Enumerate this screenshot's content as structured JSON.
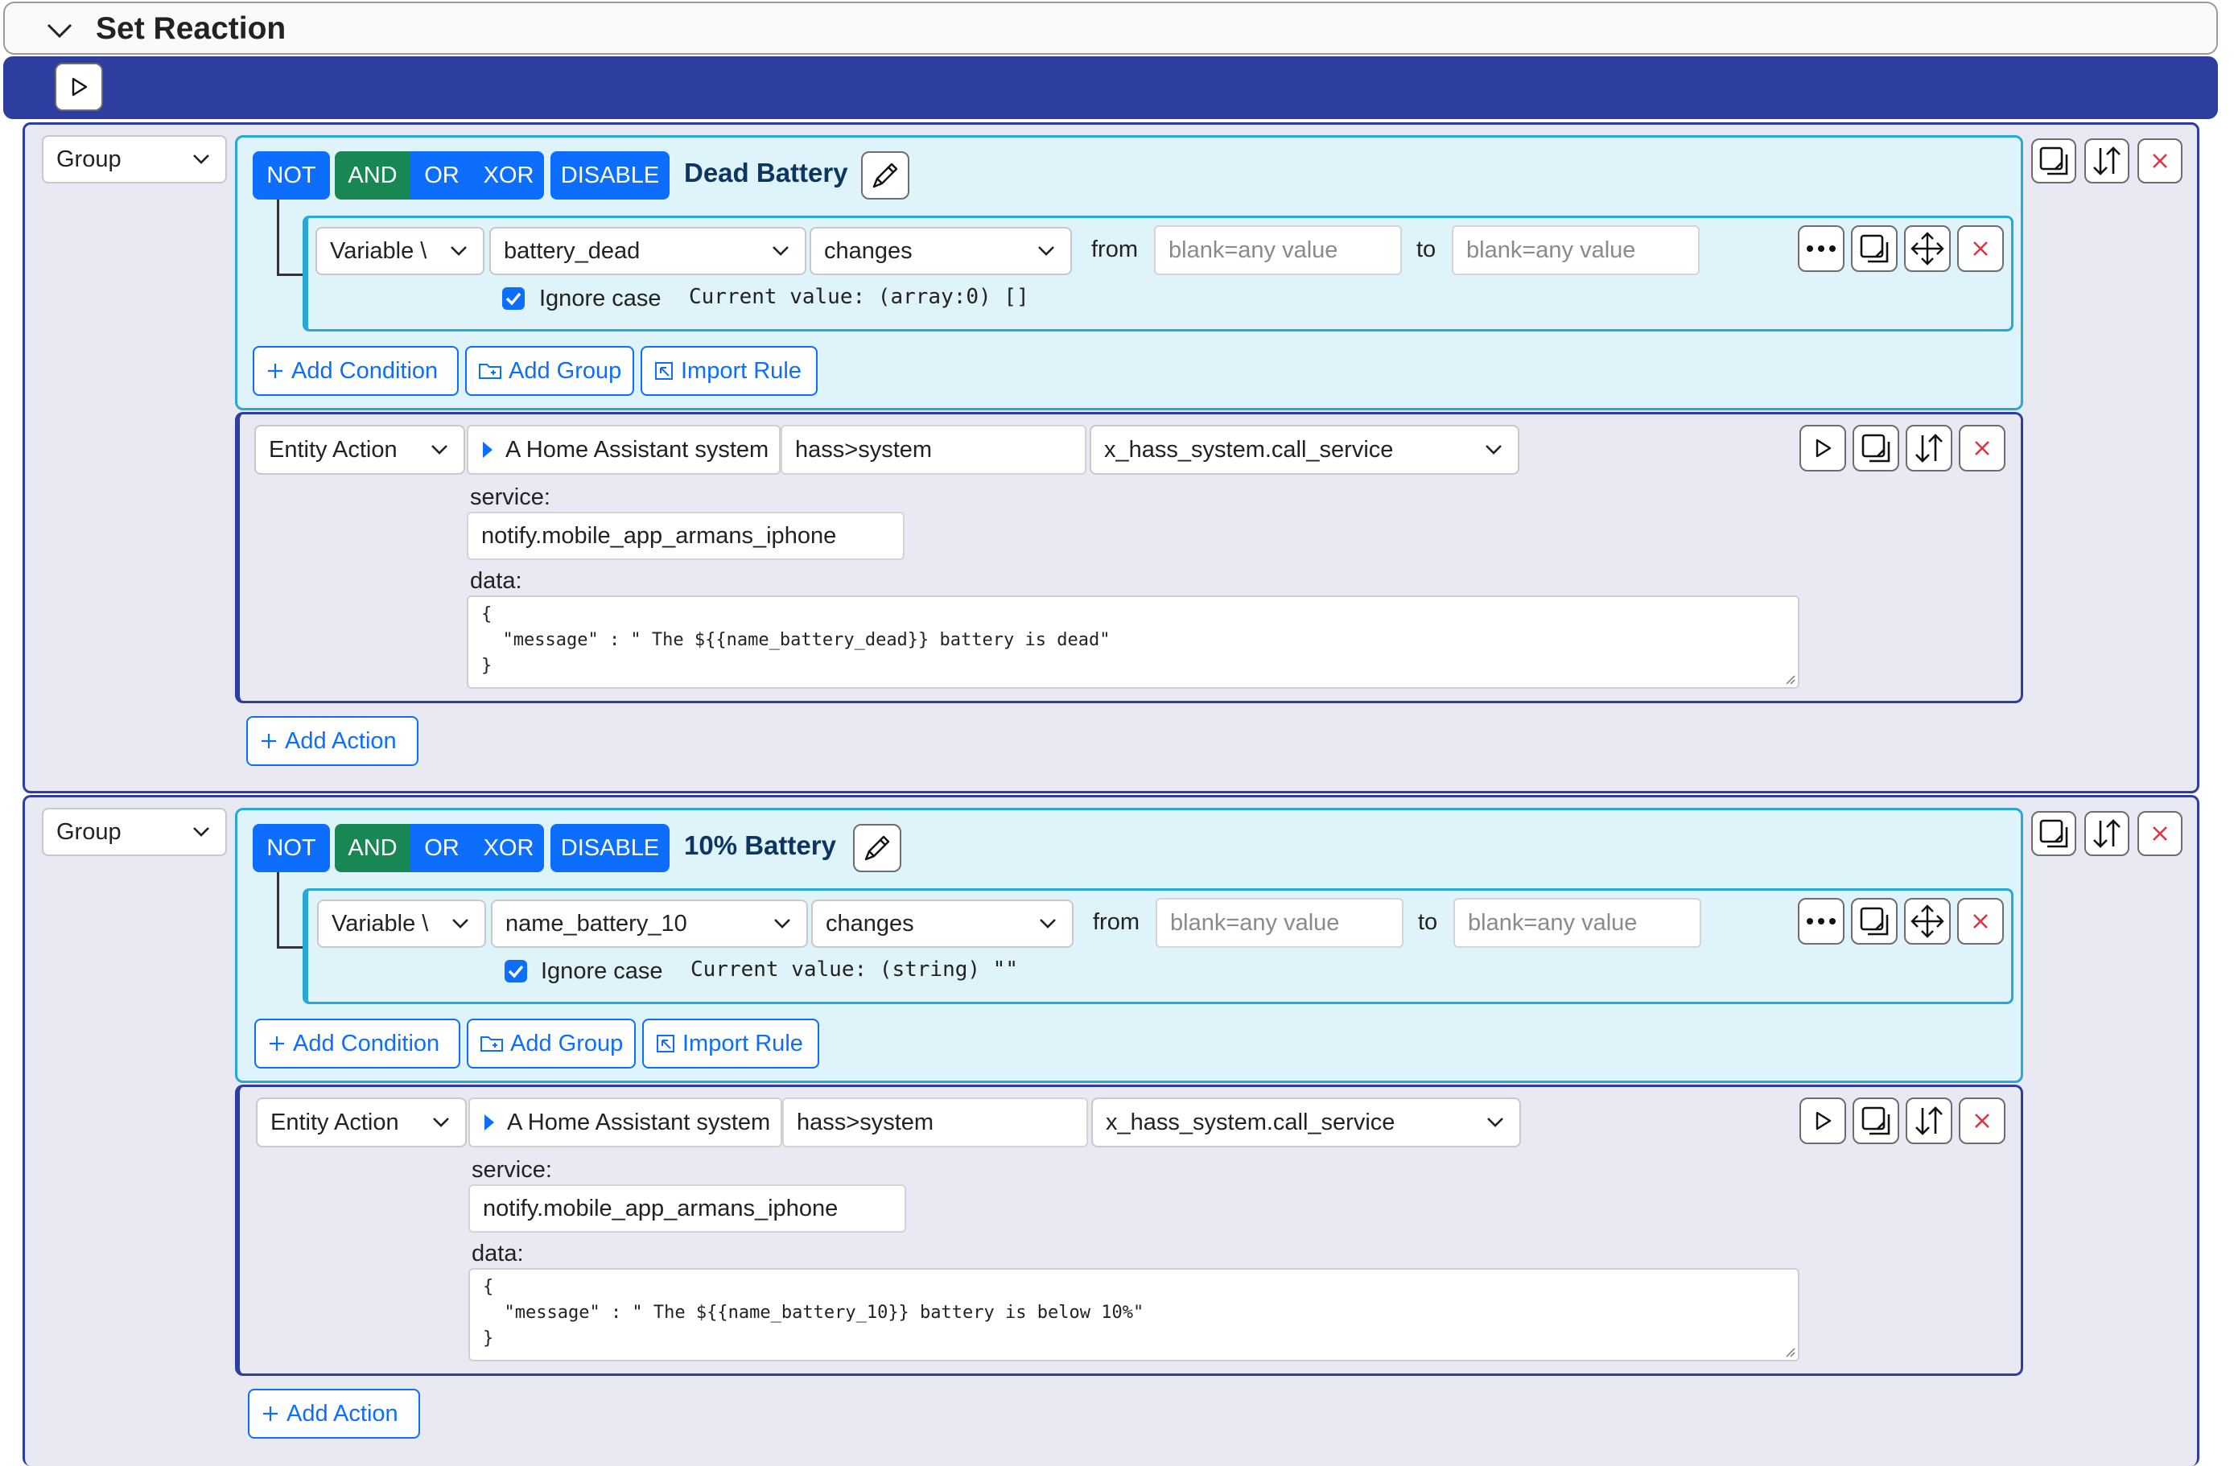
{
  "header": {
    "title": "Set Reaction"
  },
  "labels": {
    "add_condition": "Add Condition",
    "add_group": "Add Group",
    "import_rule": "Import Rule",
    "add_action": "Add Action",
    "from": "from",
    "to": "to",
    "ignore_case": "Ignore case",
    "service": "service:",
    "data": "data:",
    "blank_placeholder": "blank=any value"
  },
  "logic": {
    "not": "NOT",
    "and": "AND",
    "or": "OR",
    "xor": "XOR",
    "disable": "DISABLE"
  },
  "colors": {
    "accent": "#0d6efd",
    "and_green": "#198754",
    "navy": "#2d3da0",
    "group_border": "#28a8d6",
    "delete_red": "#dc3545"
  },
  "groups": [
    {
      "type_select": "Group",
      "name": "Dead Battery",
      "condition": {
        "source_select": "Variable \\",
        "variable_select": "battery_dead",
        "operator_select": "changes",
        "ignore_case": true,
        "current_value": "Current value: (array:0) []"
      },
      "action": {
        "type_select": "Entity Action",
        "entity_label": "A Home Assistant system",
        "entity_input": "hass>system",
        "method_select": "x_hass_system.call_service",
        "service_value": "notify.mobile_app_armans_iphone",
        "data_value": "{\n  \"message\" : \" The ${{name_battery_dead}} battery is dead\"\n}"
      }
    },
    {
      "type_select": "Group",
      "name": "10% Battery",
      "condition": {
        "source_select": "Variable \\",
        "variable_select": "name_battery_10",
        "operator_select": "changes",
        "ignore_case": true,
        "current_value": "Current value: (string) \"\""
      },
      "action": {
        "type_select": "Entity Action",
        "entity_label": "A Home Assistant system",
        "entity_input": "hass>system",
        "method_select": "x_hass_system.call_service",
        "service_value": "notify.mobile_app_armans_iphone",
        "data_value": "{\n  \"message\" : \" The ${{name_battery_10}} battery is below 10%\"\n}"
      }
    }
  ]
}
